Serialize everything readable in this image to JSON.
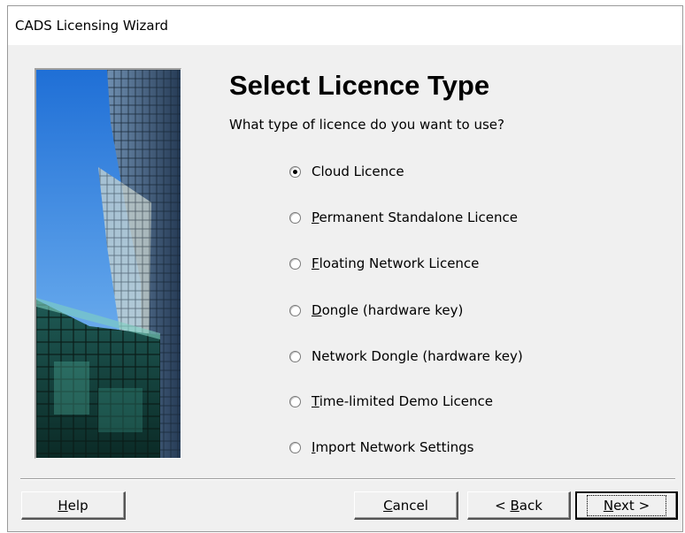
{
  "window": {
    "title": "CADS Licensing Wizard"
  },
  "page": {
    "heading": "Select Licence Type",
    "question": "What type of licence do you want to use?"
  },
  "options": [
    {
      "pre": "",
      "key": "",
      "rest": "Cloud Licence",
      "selected": true
    },
    {
      "pre": "",
      "key": "P",
      "rest": "ermanent Standalone Licence",
      "selected": false
    },
    {
      "pre": "",
      "key": "F",
      "rest": "loating Network Licence",
      "selected": false
    },
    {
      "pre": "",
      "key": "D",
      "rest": "ongle (hardware key)",
      "selected": false
    },
    {
      "pre": "",
      "key": "",
      "rest": "Network Dongle (hardware key)",
      "selected": false
    },
    {
      "pre": "",
      "key": "T",
      "rest": "ime-limited Demo Licence",
      "selected": false
    },
    {
      "pre": "",
      "key": "I",
      "rest": "mport Network Settings",
      "selected": false
    }
  ],
  "buttons": {
    "help": {
      "key": "H",
      "rest": "elp"
    },
    "cancel": {
      "key": "C",
      "rest": "ancel"
    },
    "back": {
      "pre": "< ",
      "key": "B",
      "rest": "ack"
    },
    "next": {
      "key": "N",
      "rest": "ext >"
    }
  },
  "side_image": {
    "description_icon": "office-building-photo"
  }
}
